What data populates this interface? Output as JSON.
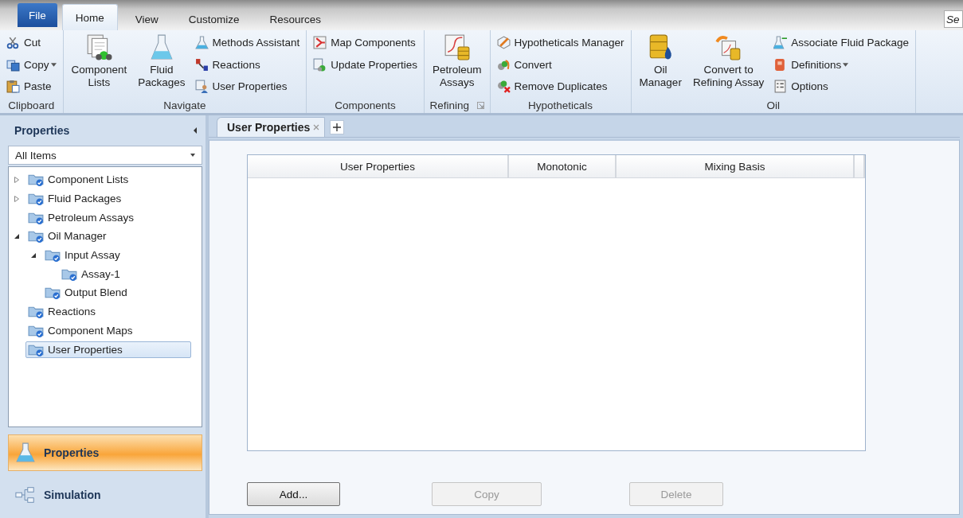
{
  "ribbon_tabs": [
    {
      "label": "File",
      "kind": "file",
      "selected": false
    },
    {
      "label": "Home",
      "kind": "tab",
      "selected": true
    },
    {
      "label": "View",
      "kind": "tab",
      "selected": false
    },
    {
      "label": "Customize",
      "kind": "tab",
      "selected": false
    },
    {
      "label": "Resources",
      "kind": "tab",
      "selected": false
    }
  ],
  "search": {
    "placeholder": "Se"
  },
  "ribbon_groups": [
    {
      "label": "Clipboard",
      "small": [
        {
          "label": "Cut",
          "dropdown": false
        },
        {
          "label": "Copy",
          "dropdown": true
        },
        {
          "label": "Paste",
          "dropdown": false
        }
      ]
    },
    {
      "label": "Navigate",
      "large": [
        {
          "label": "Component\nLists"
        },
        {
          "label": "Fluid\nPackages"
        }
      ],
      "small": [
        {
          "label": "Methods Assistant",
          "dropdown": false
        },
        {
          "label": "Reactions",
          "dropdown": false
        },
        {
          "label": "User Properties",
          "dropdown": false
        }
      ]
    },
    {
      "label": "Components",
      "small": [
        {
          "label": "Map Components",
          "dropdown": false
        },
        {
          "label": "Update Properties",
          "dropdown": false
        }
      ]
    },
    {
      "label": "Refining",
      "launcher": true,
      "large": [
        {
          "label": "Petroleum\nAssays"
        }
      ]
    },
    {
      "label": "Hypotheticals",
      "small": [
        {
          "label": "Hypotheticals Manager",
          "dropdown": false
        },
        {
          "label": "Convert",
          "dropdown": false
        },
        {
          "label": "Remove Duplicates",
          "dropdown": false
        }
      ]
    },
    {
      "label": "Oil",
      "large": [
        {
          "label": "Oil\nManager"
        },
        {
          "label": "Convert to\nRefining Assay"
        }
      ],
      "small": [
        {
          "label": "Associate Fluid Package",
          "dropdown": false
        },
        {
          "label": "Definitions",
          "dropdown": true
        },
        {
          "label": "Options",
          "dropdown": false
        }
      ]
    }
  ],
  "side_panel": {
    "title": "Properties",
    "filter": {
      "value": "All Items"
    },
    "tree": [
      {
        "label": "Component Lists",
        "expanded": false,
        "selected": false
      },
      {
        "label": "Fluid Packages",
        "expanded": false,
        "selected": false
      },
      {
        "label": "Petroleum Assays",
        "selected": false
      },
      {
        "label": "Oil Manager",
        "expanded": true,
        "selected": false,
        "children": [
          {
            "label": "Input Assay",
            "expanded": true,
            "selected": false,
            "children": [
              {
                "label": "Assay-1",
                "selected": false
              }
            ]
          },
          {
            "label": "Output Blend",
            "selected": false
          }
        ]
      },
      {
        "label": "Reactions",
        "selected": false
      },
      {
        "label": "Component Maps",
        "selected": false
      },
      {
        "label": "User Properties",
        "selected": true
      }
    ],
    "nav": [
      {
        "label": "Properties",
        "kind": "flask",
        "selected": true
      },
      {
        "label": "Simulation",
        "kind": "flow",
        "selected": false
      }
    ]
  },
  "doc_tabs": [
    {
      "label": "User Properties",
      "selected": true
    }
  ],
  "table": {
    "columns": [
      "User Properties",
      "Monotonic",
      "Mixing Basis"
    ]
  },
  "buttons": [
    {
      "label": "Add...",
      "disabled": false
    },
    {
      "label": "Copy",
      "disabled": true
    },
    {
      "label": "Delete",
      "disabled": true
    }
  ]
}
